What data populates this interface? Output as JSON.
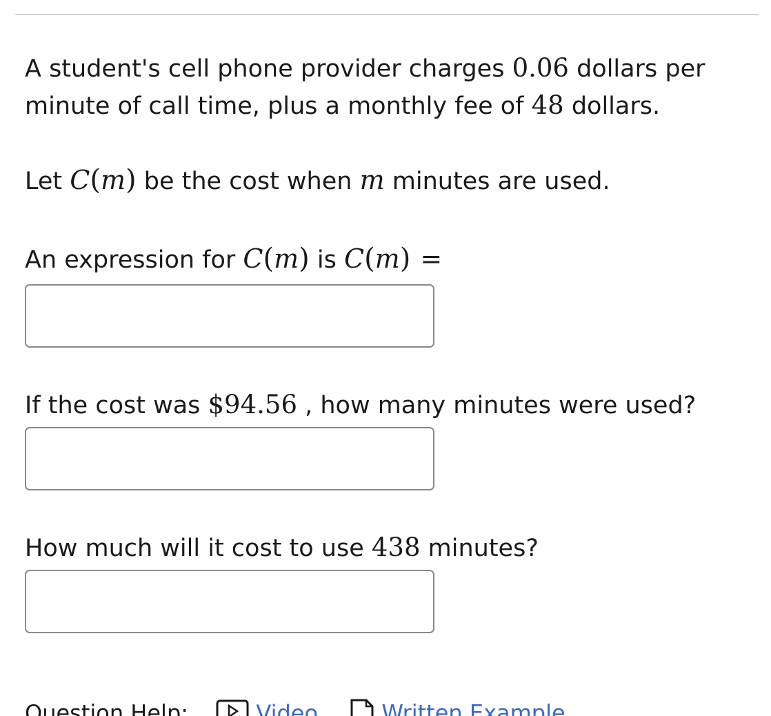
{
  "question": {
    "line1": {
      "t1": "A student's cell phone provider charges ",
      "rate": "0.06",
      "t2": " dollars per"
    },
    "line2": {
      "t1": "minute of call time, plus a monthly fee of ",
      "fee": "48",
      "t2": " dollars."
    },
    "definition": {
      "t1": "Let ",
      "func": "C",
      "lparen": "(",
      "var": "m",
      "rparen": ")",
      "t2": " be the cost when ",
      "var2": "m",
      "t3": " minutes are used."
    }
  },
  "part1": {
    "t1": "An expression for ",
    "func": "C",
    "lparen": "(",
    "var": "m",
    "rparen": ")",
    "t2": " is ",
    "func2": "C",
    "lparen2": "(",
    "var2": "m",
    "rparen2": ")",
    "eq": "=",
    "answer_value": ""
  },
  "part2": {
    "t1": "If the cost was ",
    "cost": "$94.56",
    "t2": " , how many minutes were used?",
    "answer_value": ""
  },
  "part3": {
    "t1": "How much will it cost to use ",
    "minutes": "438",
    "t2": " minutes?",
    "answer_value": ""
  },
  "help": {
    "label": "Question Help:",
    "video_label": "Video",
    "video_icon": "video-icon",
    "example_label": "Written Example",
    "example_icon": "document-icon",
    "link_color": "#3b68c9"
  }
}
